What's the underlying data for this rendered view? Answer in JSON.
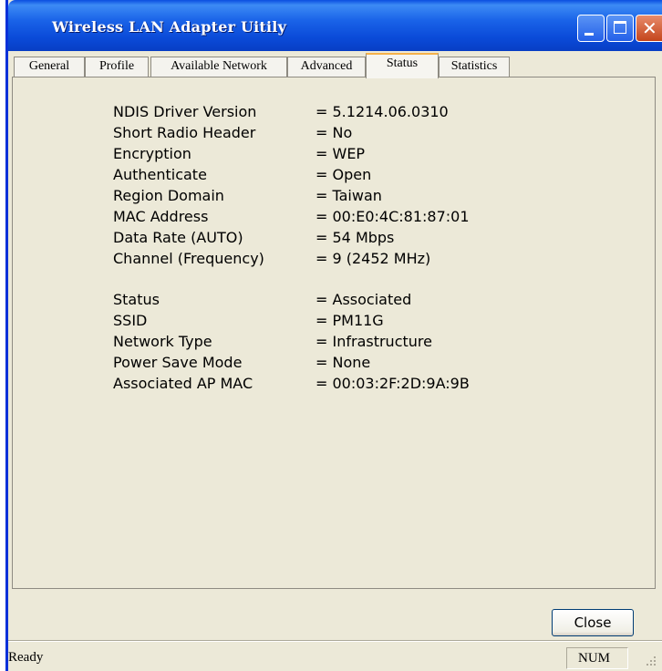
{
  "window": {
    "title": "Wireless LAN Adapter Uitily"
  },
  "tabs": [
    {
      "label": "General"
    },
    {
      "label": "Profile"
    },
    {
      "label": "Available Network"
    },
    {
      "label": "Advanced"
    },
    {
      "label": "Status"
    },
    {
      "label": "Statistics"
    }
  ],
  "active_tab": "Status",
  "status_info": {
    "group1": [
      {
        "label": "NDIS Driver Version",
        "value": "= 5.1214.06.0310"
      },
      {
        "label": "Short Radio Header",
        "value": "= No"
      },
      {
        "label": "Encryption",
        "value": "= WEP"
      },
      {
        "label": "Authenticate",
        "value": "= Open"
      },
      {
        "label": "Region Domain",
        "value": "= Taiwan"
      },
      {
        "label": "MAC Address",
        "value": "= 00:E0:4C:81:87:01"
      },
      {
        "label": "Data Rate (AUTO)",
        "value": "= 54 Mbps"
      },
      {
        "label": "Channel (Frequency)",
        "value": "= 9 (2452 MHz)"
      }
    ],
    "group2": [
      {
        "label": "Status",
        "value": "= Associated"
      },
      {
        "label": "SSID",
        "value": "= PM11G"
      },
      {
        "label": "Network Type",
        "value": "= Infrastructure"
      },
      {
        "label": "Power Save Mode",
        "value": "= None"
      },
      {
        "label": "Associated AP MAC",
        "value": "= 00:03:2F:2D:9A:9B"
      }
    ]
  },
  "buttons": {
    "close_label": "Close"
  },
  "statusbar": {
    "left_text": "Ready",
    "num_indicator": "NUM"
  },
  "colors": {
    "titlebar": "#0a4ad8",
    "window_bg": "#ece9d8",
    "active_tab_accent": "#f5b14a",
    "close_titlebar_button": "#c4451c"
  }
}
